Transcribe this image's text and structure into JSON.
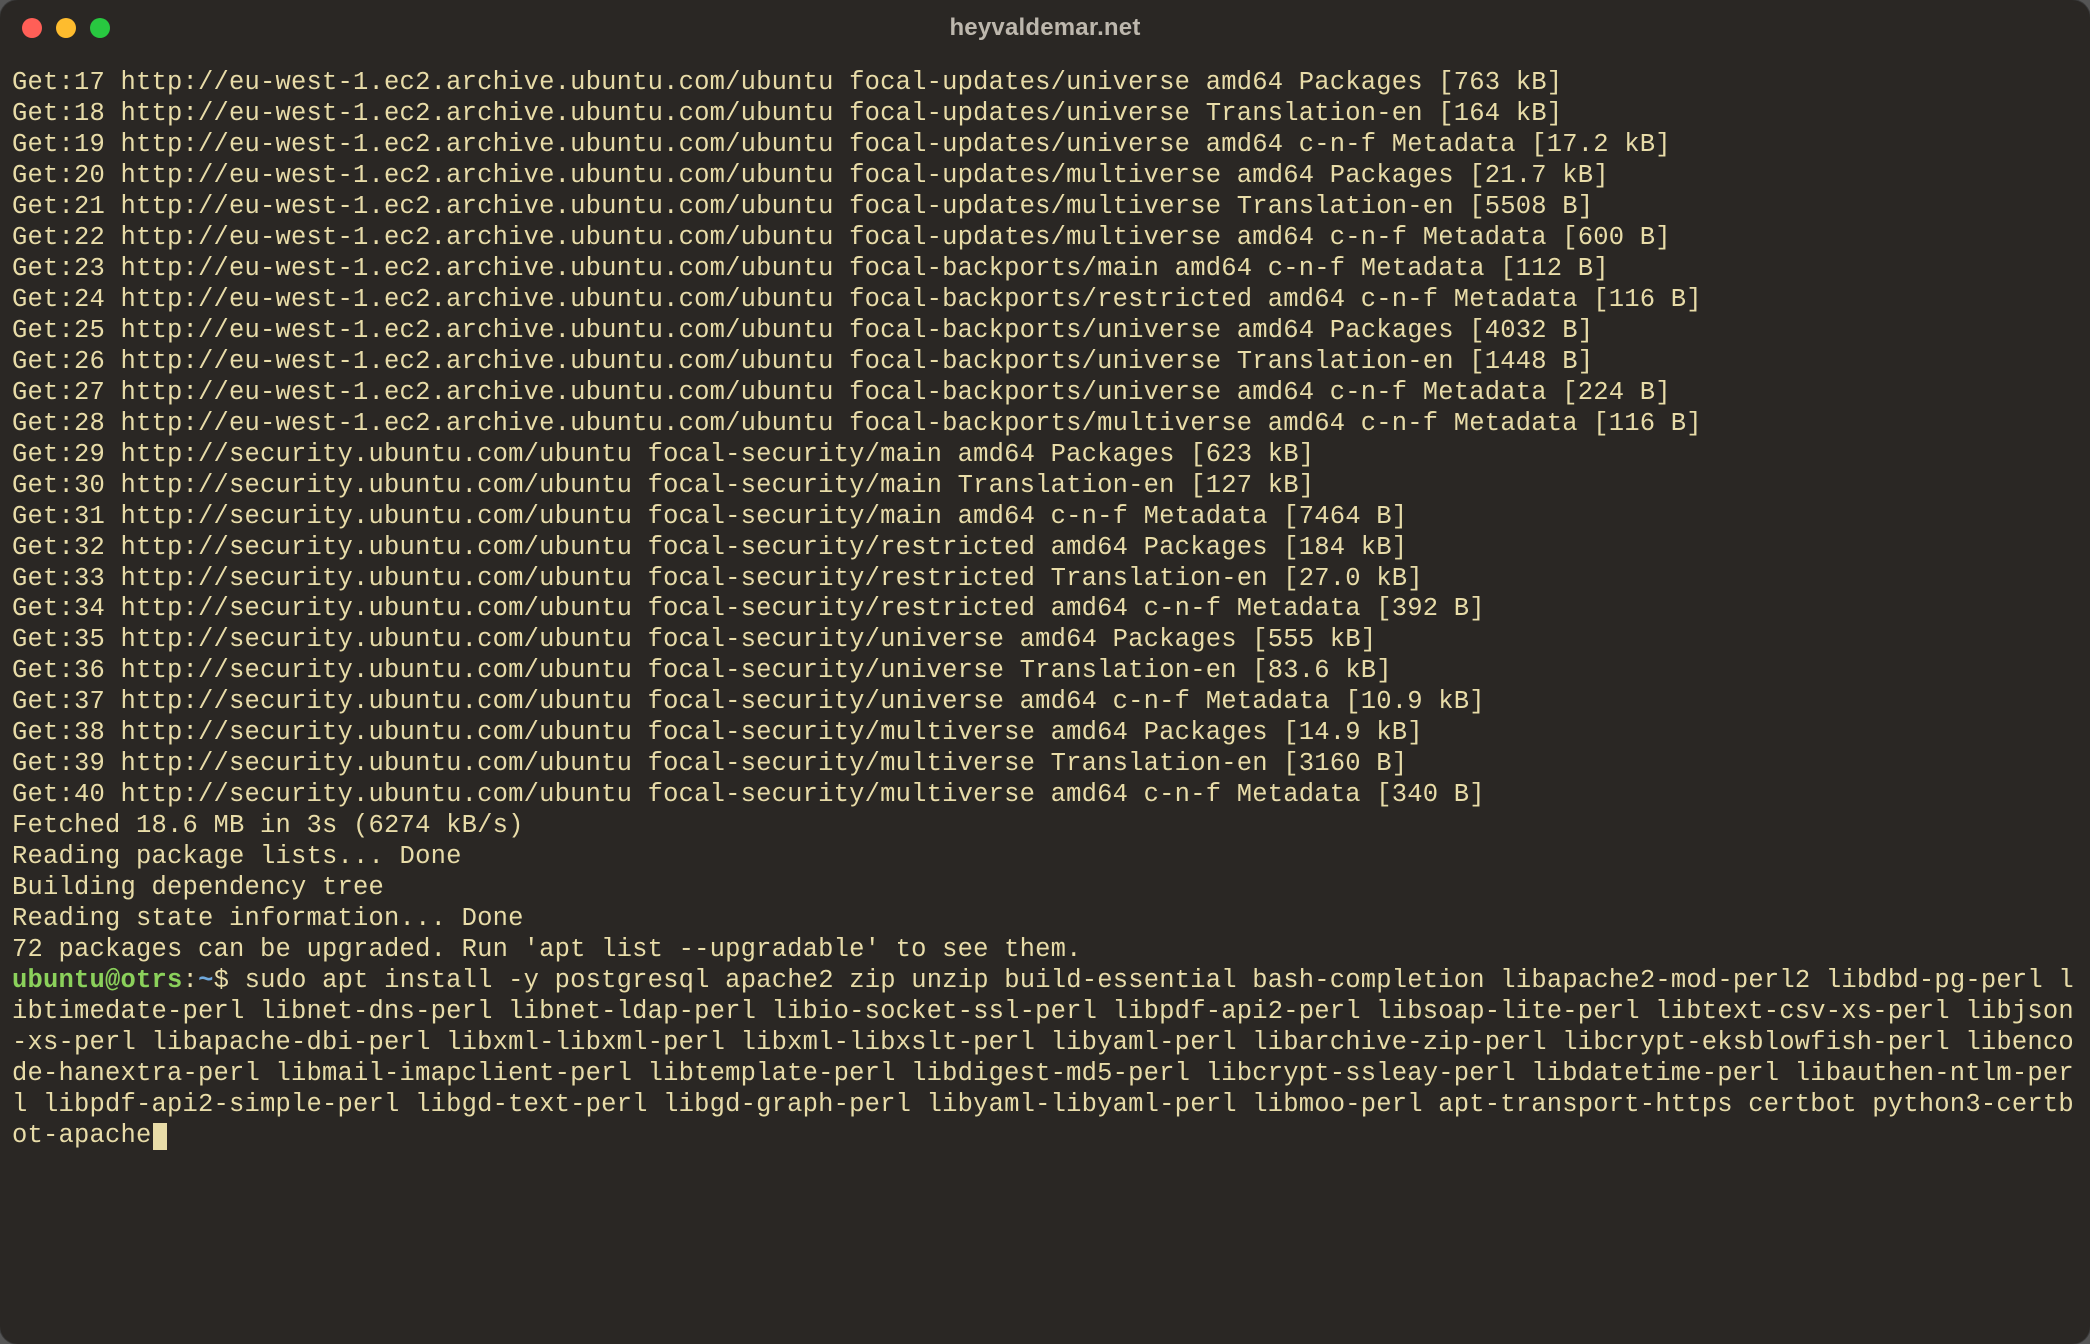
{
  "window": {
    "title": "heyvaldemar.net"
  },
  "output_lines": [
    "Get:17 http://eu-west-1.ec2.archive.ubuntu.com/ubuntu focal-updates/universe amd64 Packages [763 kB]",
    "Get:18 http://eu-west-1.ec2.archive.ubuntu.com/ubuntu focal-updates/universe Translation-en [164 kB]",
    "Get:19 http://eu-west-1.ec2.archive.ubuntu.com/ubuntu focal-updates/universe amd64 c-n-f Metadata [17.2 kB]",
    "Get:20 http://eu-west-1.ec2.archive.ubuntu.com/ubuntu focal-updates/multiverse amd64 Packages [21.7 kB]",
    "Get:21 http://eu-west-1.ec2.archive.ubuntu.com/ubuntu focal-updates/multiverse Translation-en [5508 B]",
    "Get:22 http://eu-west-1.ec2.archive.ubuntu.com/ubuntu focal-updates/multiverse amd64 c-n-f Metadata [600 B]",
    "Get:23 http://eu-west-1.ec2.archive.ubuntu.com/ubuntu focal-backports/main amd64 c-n-f Metadata [112 B]",
    "Get:24 http://eu-west-1.ec2.archive.ubuntu.com/ubuntu focal-backports/restricted amd64 c-n-f Metadata [116 B]",
    "Get:25 http://eu-west-1.ec2.archive.ubuntu.com/ubuntu focal-backports/universe amd64 Packages [4032 B]",
    "Get:26 http://eu-west-1.ec2.archive.ubuntu.com/ubuntu focal-backports/universe Translation-en [1448 B]",
    "Get:27 http://eu-west-1.ec2.archive.ubuntu.com/ubuntu focal-backports/universe amd64 c-n-f Metadata [224 B]",
    "Get:28 http://eu-west-1.ec2.archive.ubuntu.com/ubuntu focal-backports/multiverse amd64 c-n-f Metadata [116 B]",
    "Get:29 http://security.ubuntu.com/ubuntu focal-security/main amd64 Packages [623 kB]",
    "Get:30 http://security.ubuntu.com/ubuntu focal-security/main Translation-en [127 kB]",
    "Get:31 http://security.ubuntu.com/ubuntu focal-security/main amd64 c-n-f Metadata [7464 B]",
    "Get:32 http://security.ubuntu.com/ubuntu focal-security/restricted amd64 Packages [184 kB]",
    "Get:33 http://security.ubuntu.com/ubuntu focal-security/restricted Translation-en [27.0 kB]",
    "Get:34 http://security.ubuntu.com/ubuntu focal-security/restricted amd64 c-n-f Metadata [392 B]",
    "Get:35 http://security.ubuntu.com/ubuntu focal-security/universe amd64 Packages [555 kB]",
    "Get:36 http://security.ubuntu.com/ubuntu focal-security/universe Translation-en [83.6 kB]",
    "Get:37 http://security.ubuntu.com/ubuntu focal-security/universe amd64 c-n-f Metadata [10.9 kB]",
    "Get:38 http://security.ubuntu.com/ubuntu focal-security/multiverse amd64 Packages [14.9 kB]",
    "Get:39 http://security.ubuntu.com/ubuntu focal-security/multiverse Translation-en [3160 B]",
    "Get:40 http://security.ubuntu.com/ubuntu focal-security/multiverse amd64 c-n-f Metadata [340 B]",
    "Fetched 18.6 MB in 3s (6274 kB/s)",
    "Reading package lists... Done",
    "Building dependency tree",
    "Reading state information... Done",
    "72 packages can be upgraded. Run 'apt list --upgradable' to see them."
  ],
  "prompt": {
    "user": "ubuntu",
    "at": "@",
    "host": "otrs",
    "colon": ":",
    "path": "~",
    "symbol": "$"
  },
  "command": "sudo apt install -y postgresql apache2 zip unzip build-essential bash-completion libapache2-mod-perl2 libdbd-pg-perl libtimedate-perl libnet-dns-perl libnet-ldap-perl libio-socket-ssl-perl libpdf-api2-perl libsoap-lite-perl libtext-csv-xs-perl libjson-xs-perl libapache-dbi-perl libxml-libxml-perl libxml-libxslt-perl libyaml-perl libarchive-zip-perl libcrypt-eksblowfish-perl libencode-hanextra-perl libmail-imapclient-perl libtemplate-perl libdigest-md5-perl libcrypt-ssleay-perl libdatetime-perl libauthen-ntlm-perl libpdf-api2-simple-perl libgd-text-perl libgd-graph-perl libyaml-libyaml-perl libmoo-perl apt-transport-https certbot python3-certbot-apache"
}
